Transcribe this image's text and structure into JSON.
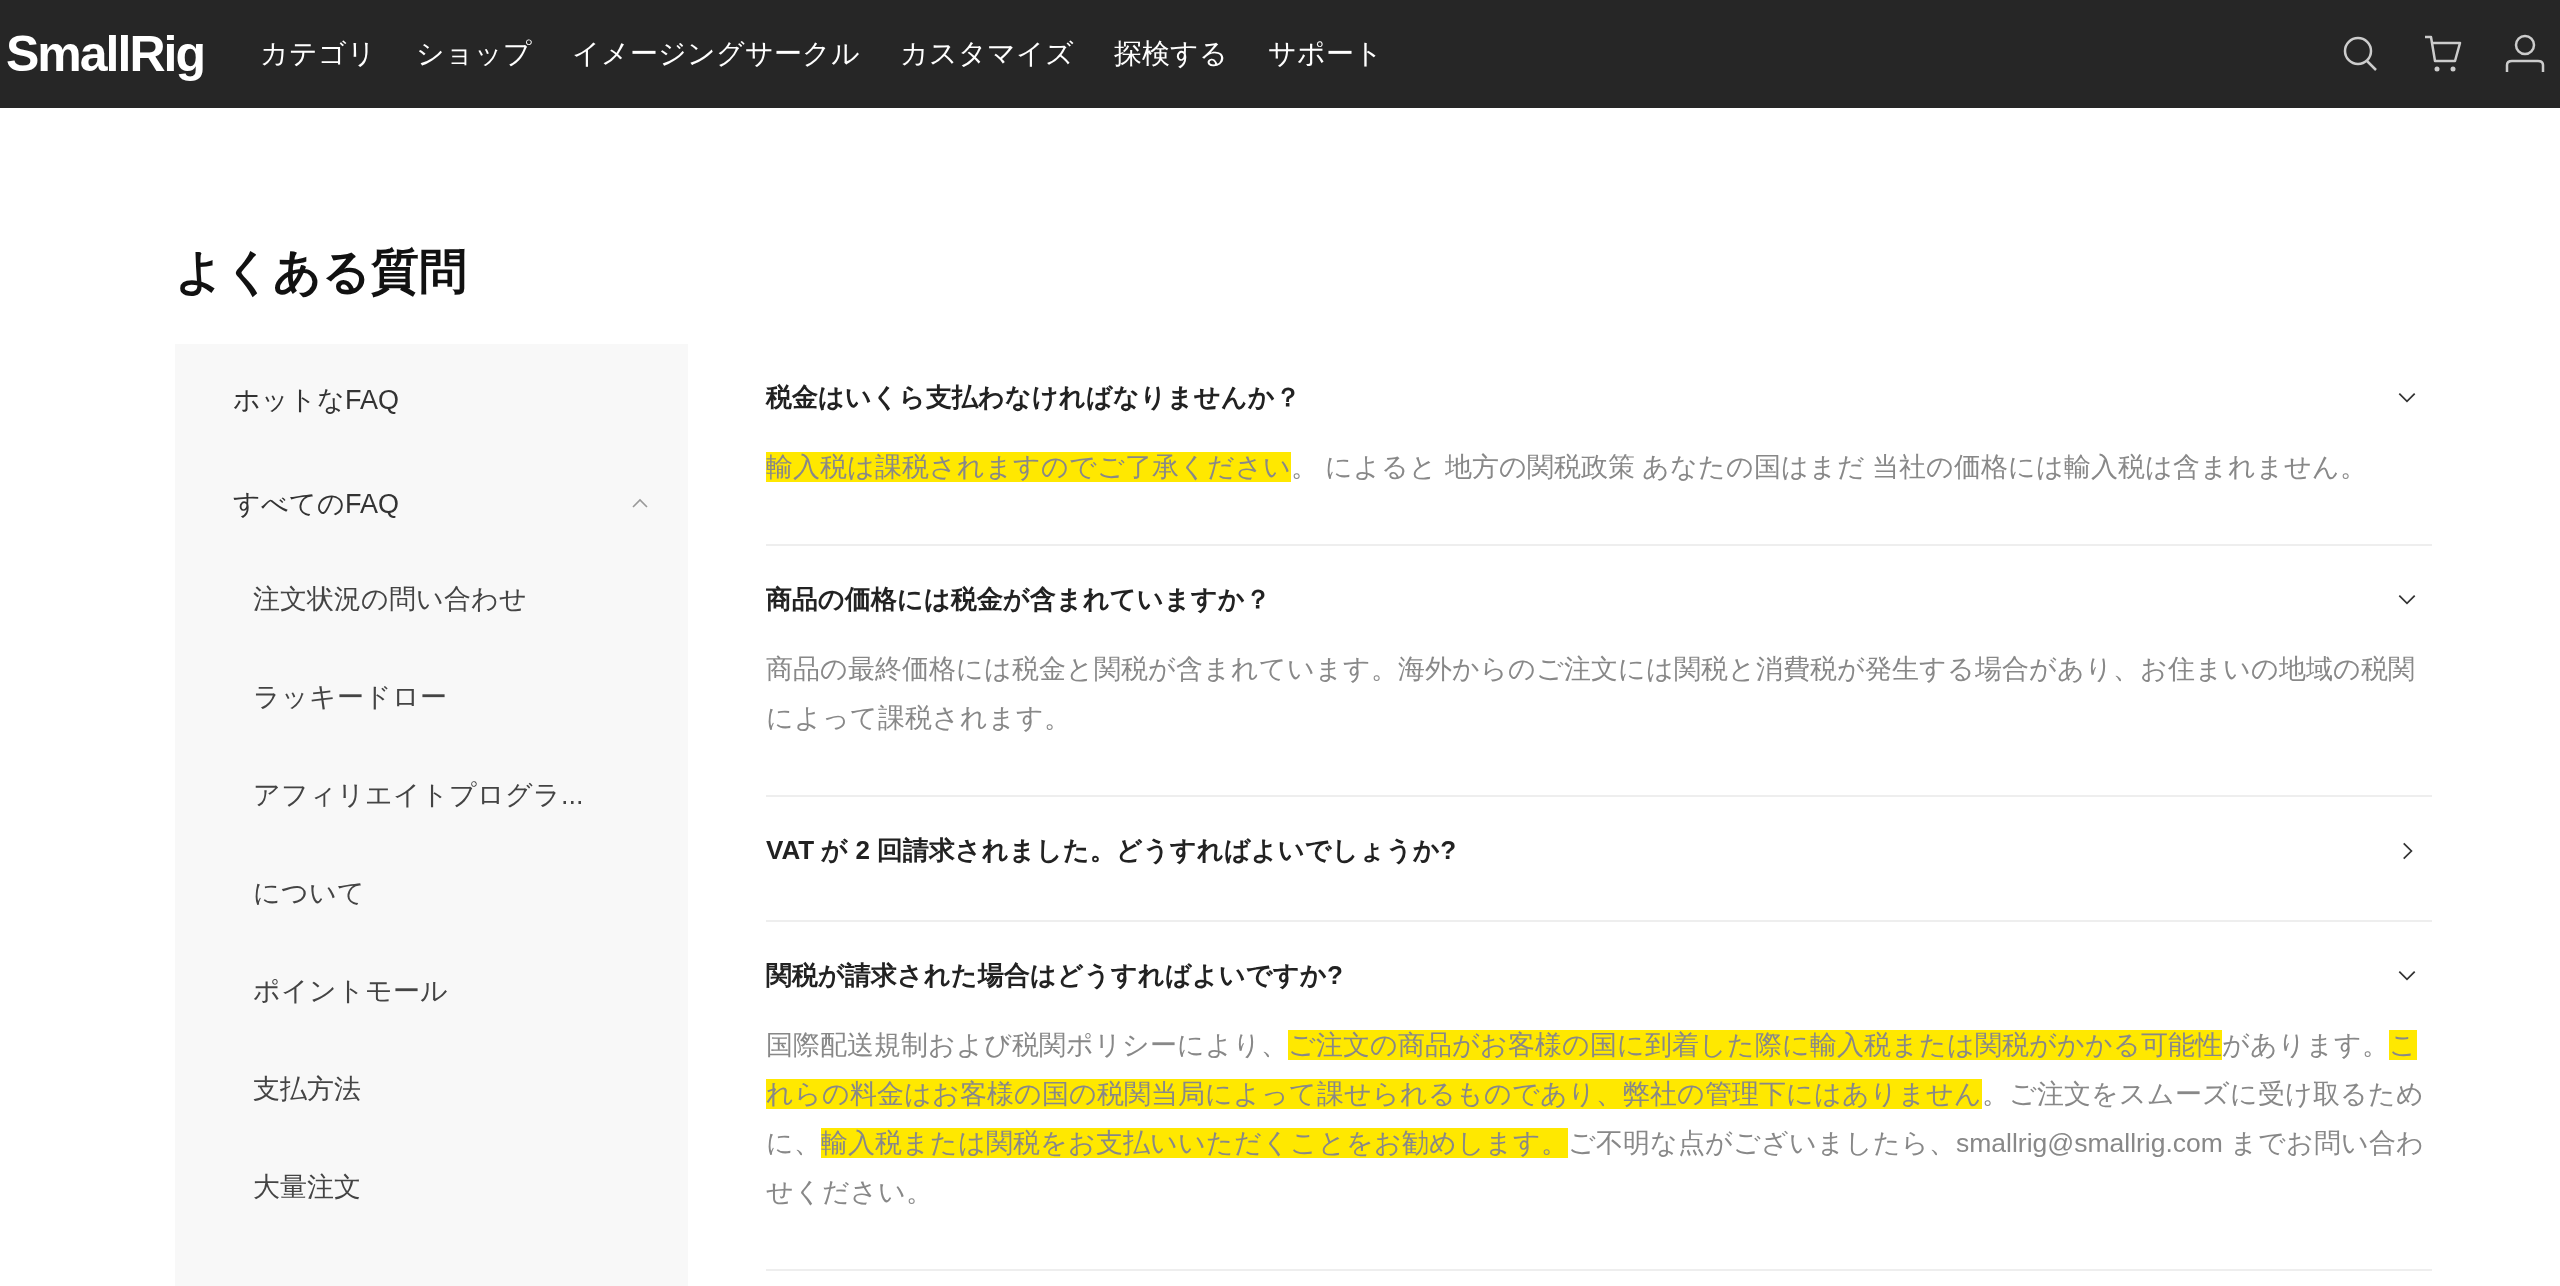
{
  "header": {
    "logo": "SmallRig",
    "nav": [
      "カテゴリ",
      "ショップ",
      "イメージングサークル",
      "カスタマイズ",
      "探検する",
      "サポート"
    ]
  },
  "page_title": "よくある質問",
  "sidebar": {
    "items": [
      {
        "label": "ホットなFAQ"
      },
      {
        "label": "すべてのFAQ",
        "expanded": true,
        "children": [
          {
            "label": "注文状況の問い合わせ"
          },
          {
            "label": "ラッキードロー"
          },
          {
            "label": "アフィリエイトプログラ..."
          },
          {
            "label": "について"
          },
          {
            "label": "ポイントモール"
          },
          {
            "label": "支払方法"
          },
          {
            "label": "大量注文"
          }
        ]
      }
    ]
  },
  "faq": [
    {
      "question": "税金はいくら支払わなければなりませんか？",
      "expanded": true,
      "answer": [
        {
          "text": "輸入税は課税されますのでご了承ください",
          "highlighted": true
        },
        {
          "text": "。 によると 地方の関税政策 あなたの国はまだ 当社の価格には輸入税は含まれません。",
          "highlighted": false
        }
      ]
    },
    {
      "question": "商品の価格には税金が含まれていますか？",
      "expanded": true,
      "answer": [
        {
          "text": "商品の最終価格には税金と関税が含まれています。海外からのご注文には関税と消費税が発生する場合があり、お住まいの地域の税関によって課税されます。",
          "highlighted": false
        }
      ]
    },
    {
      "question": "VAT が 2 回請求されました。どうすればよいでしょうか?",
      "expanded": false
    },
    {
      "question": "関税が請求された場合はどうすればよいですか?",
      "expanded": true,
      "answer": [
        {
          "text": "国際配送規制および税関ポリシーにより、",
          "highlighted": false
        },
        {
          "text": "ご注文の商品がお客様の国に到着した際に輸入税または関税がかかる可能性",
          "highlighted": true
        },
        {
          "text": "があります。",
          "highlighted": false
        },
        {
          "text": "これらの料金はお客様の国の税関当局によって課せられるものであり、弊社の管理下にはありません",
          "highlighted": true
        },
        {
          "text": "。ご注文をスムーズに受け取るために、",
          "highlighted": false
        },
        {
          "text": "輸入税または関税をお支払いいただくことをお勧めします。",
          "highlighted": true
        },
        {
          "text": "ご不明な点がございましたら、smallrig@smallrig.com までお問い合わせください。",
          "highlighted": false
        }
      ]
    }
  ]
}
